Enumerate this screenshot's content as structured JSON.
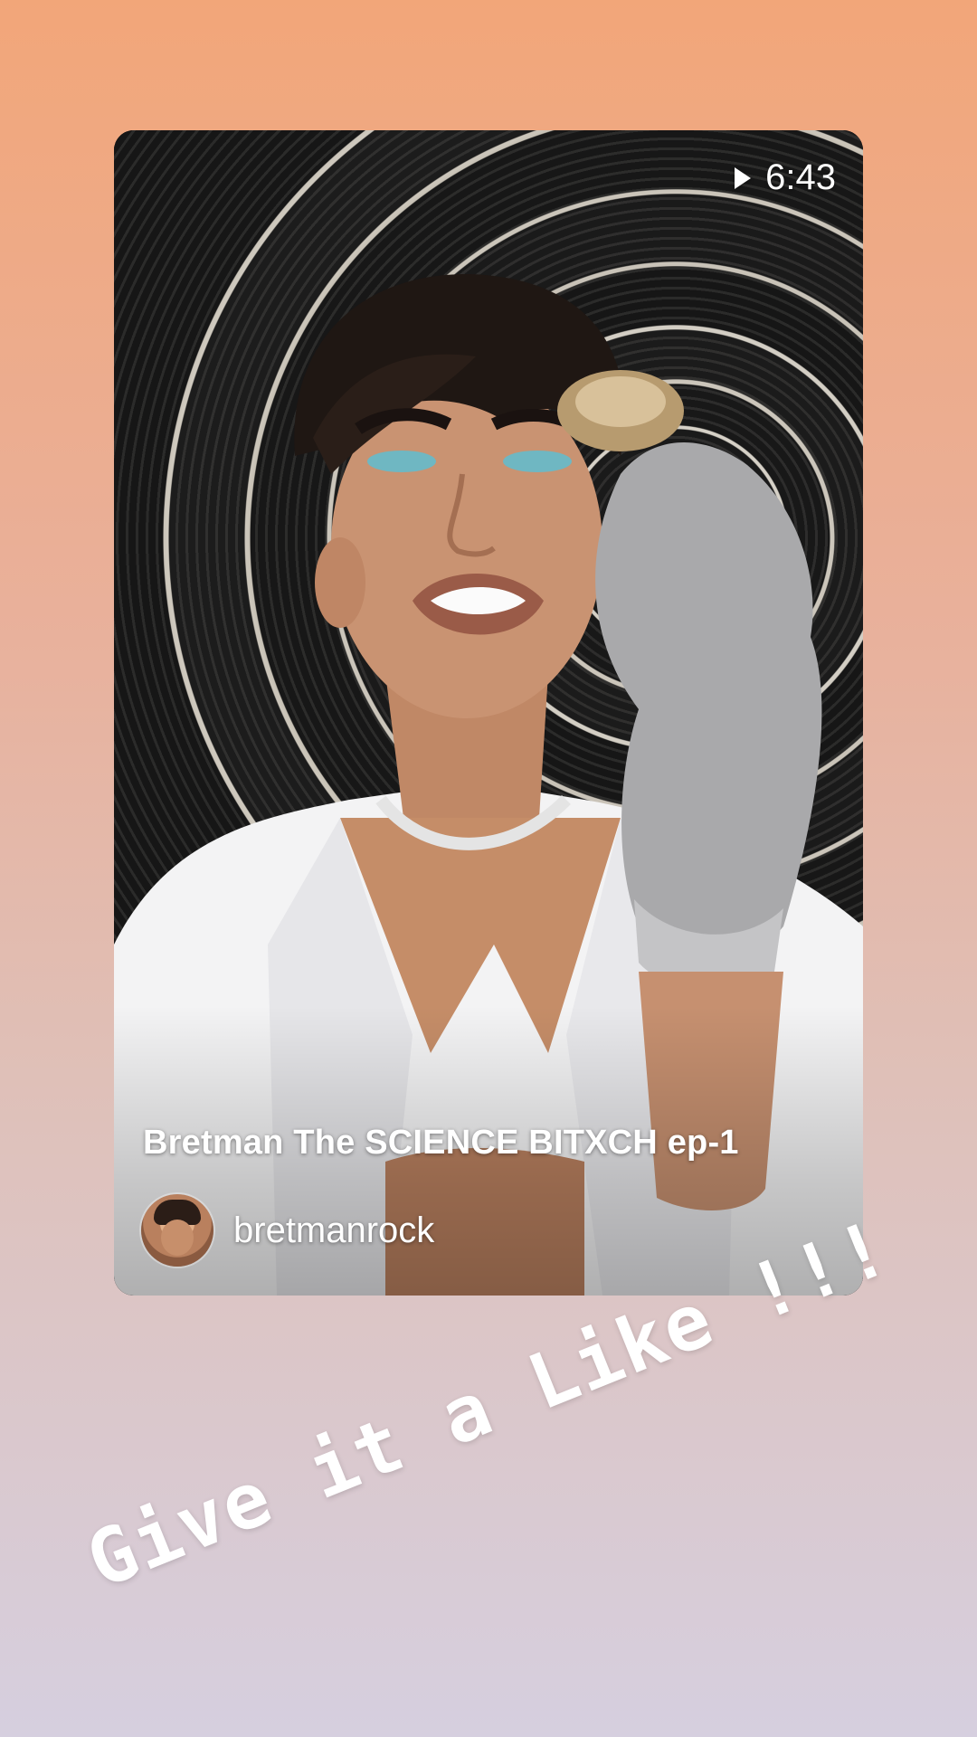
{
  "post": {
    "duration": "6:43",
    "title": "Bretman The SCIENCE BITXCH ep-1",
    "author": "bretmanrock"
  },
  "sticker": {
    "text": "Give it a Like !!!"
  },
  "icons": {
    "play": "play-icon",
    "avatar": "avatar"
  },
  "colors": {
    "background_top": "#f2a679",
    "background_bottom": "#d6cfdf",
    "text": "#ffffff"
  }
}
